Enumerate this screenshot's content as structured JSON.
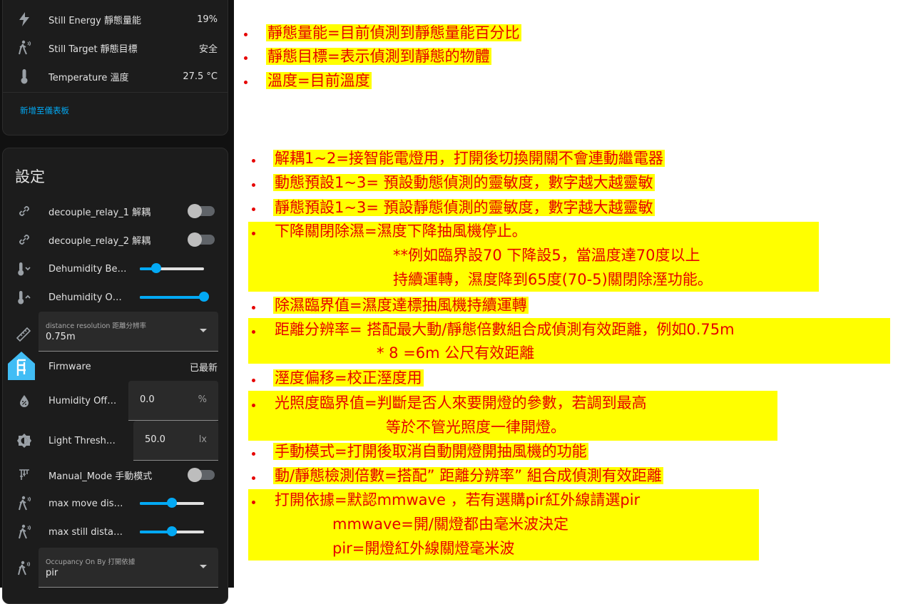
{
  "sensors": [
    {
      "label": "Still Energy 靜態量能",
      "value": "19%",
      "icon": "lightning-icon"
    },
    {
      "label": "Still Target 靜態目標",
      "value": "安全",
      "icon": "person-still-icon"
    },
    {
      "label": "Temperature 溫度",
      "value": "27.5 °C",
      "icon": "thermometer-icon"
    }
  ],
  "add_to_dashboard": "新增至儀表板",
  "settings": {
    "title": "設定",
    "decouple1": {
      "label": "decouple_relay_1 解耦",
      "state": false
    },
    "decouple2": {
      "label": "decouple_relay_2 解耦",
      "state": false
    },
    "dehum_below": {
      "label": "Dehumidity Be…",
      "level": 0.25
    },
    "dehum_over": {
      "label": "Dehumidity O…",
      "level": 1.0
    },
    "distance_resolution": {
      "label": "distance resolution 距離分辨率",
      "value": "0.75m"
    },
    "firmware": {
      "label": "Firmware",
      "value": "已最新"
    },
    "humidity_offset": {
      "label": "Humidity Off…",
      "value": "0.0",
      "unit": "%"
    },
    "light_threshold": {
      "label": "Light Thresh…",
      "value": "50.0",
      "unit": "lx"
    },
    "manual_mode": {
      "label": "Manual_Mode 手動模式",
      "state": false
    },
    "max_move": {
      "label": "max move dis…",
      "level": 0.5
    },
    "max_still": {
      "label": "max still dista…",
      "level": 0.5
    },
    "occupancy": {
      "label": "Occupancy On By 打開依據",
      "value": "pir"
    }
  },
  "annotations_top": [
    "靜態量能=目前偵測到靜態量能百分比",
    "靜態目標=表示偵測到靜態的物體",
    "溫度=目前溫度"
  ],
  "annotations_main": {
    "a1": "解耦1~2=接智能電燈用，打開後切換開關不會連動繼電器",
    "a2": "動態預設1~3= 預設動態偵測的靈敏度，數字越大越靈敏",
    "a3": "靜態預設1~3= 預設靜態偵測的靈敏度，數字越大越靈敏",
    "a4": "下降關閉除濕=濕度下降抽風機停止。",
    "a4c1": "**例如臨界設70 下降設5，當溫度達70度以上",
    "a4c2": "持續運轉，濕度降到65度(70-5)關閉除溼功能。",
    "a5": "除濕臨界值=濕度達標抽風機持續運轉",
    "a6": "距離分辨率= 搭配最大動/靜態倍數組合成偵測有效距離，例如0.75m",
    "a6c1": "* 8 =6m 公尺有效距離",
    "a7": "溼度偏移=校正溼度用",
    "a8": "光照度臨界值=判斷是否人來要開燈的參數，若調到最高",
    "a8c1": "等於不管光照度一律開燈。",
    "a9": "手動模式=打開後取消自動開燈開抽風機的功能",
    "a10": "動/靜態檢測倍數=搭配” 距離分辨率” 組合成偵測有效距離",
    "a11": "打開依據=默認mmwave ，若有選購pir紅外線請選pir",
    "a11c1": "mmwave=開/關燈都由毫米波決定",
    "a11c2": "pir=開燈紅外線關燈毫米波"
  },
  "colors": {
    "accent": "#03a9f4",
    "annotation_text": "#e60000",
    "highlight": "#ffff00",
    "panel_bg": "#1c1c1c"
  }
}
